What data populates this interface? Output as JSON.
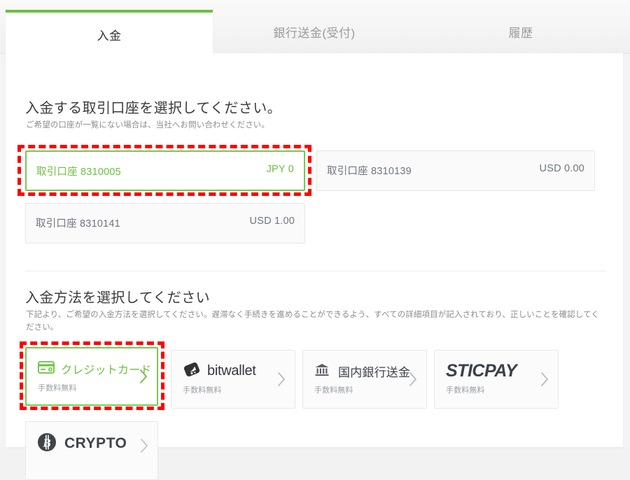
{
  "tabs": [
    {
      "label": "入金",
      "active": true
    },
    {
      "label": "銀行送金(受付)",
      "active": false
    },
    {
      "label": "履歴",
      "active": false
    }
  ],
  "accounts_section": {
    "title": "入金する取引口座を選択してください。",
    "subtitle": "ご希望の口座が一覧にない場合は、当社へお問い合わせください。",
    "items": [
      {
        "name": "取引口座 8310005",
        "balance": "JPY 0",
        "selected": true
      },
      {
        "name": "取引口座 8310139",
        "balance": "USD 0.00",
        "selected": false
      },
      {
        "name": "取引口座 8310141",
        "balance": "USD 1.00",
        "selected": false
      }
    ]
  },
  "methods_section": {
    "title": "入金方法を選択してください",
    "subtitle": "下記より、ご希望の入金方法を選択してください。遅滞なく手続きを進めることができるよう、すべての詳細項目が記入されており、正しいことを確認してください。",
    "items": [
      {
        "label": "クレジットカード",
        "fee": "手数料無料",
        "icon": "credit-card-icon",
        "selected": true
      },
      {
        "label": "bitwallet",
        "fee": "手数料無料",
        "icon": "bitwallet-icon",
        "selected": false
      },
      {
        "label": "国内銀行送金",
        "fee": "手数料無料",
        "icon": "bank-icon",
        "selected": false
      },
      {
        "label": "STICPAY",
        "fee": "手数料無料",
        "icon": "sticpay-icon",
        "selected": false
      },
      {
        "label": "CRYPTO",
        "fee": "",
        "icon": "bitcoin-icon",
        "selected": false
      }
    ]
  },
  "annotations": {
    "highlight_color": "#ff0000",
    "boxes": [
      "selected-account-highlight",
      "selected-method-highlight"
    ]
  },
  "colors": {
    "accent_green": "#6cbf3f",
    "border_green": "#78c850",
    "text_dark": "#3b3b3b",
    "text_muted": "#8c8c8c"
  }
}
